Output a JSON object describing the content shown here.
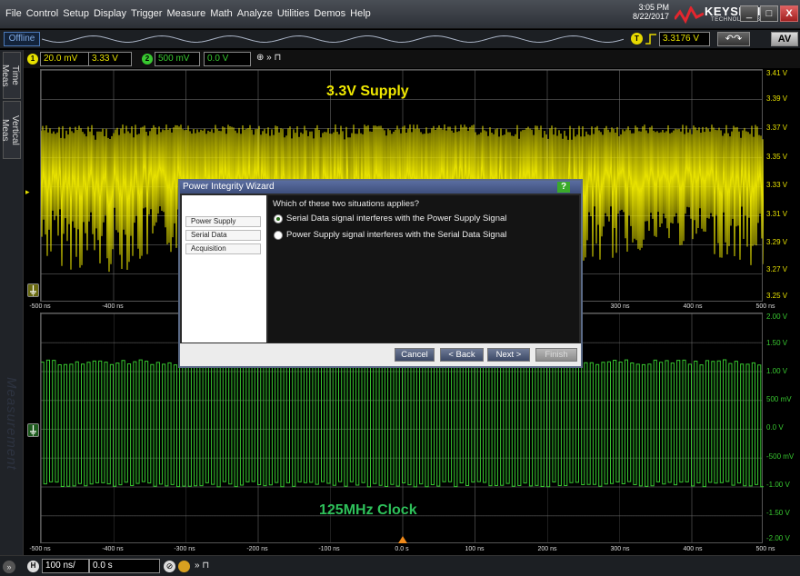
{
  "menu": [
    "File",
    "Control",
    "Setup",
    "Display",
    "Trigger",
    "Measure",
    "Math",
    "Analyze",
    "Utilities",
    "Demos",
    "Help"
  ],
  "clock": {
    "time": "3:05 PM",
    "date": "8/22/2017"
  },
  "brand": {
    "name": "KEYSIGHT",
    "sub": "TECHNOLOGIES"
  },
  "window_buttons": {
    "minimize": "_",
    "maximize": "□",
    "close": "X"
  },
  "status": {
    "offline": "Offline",
    "trigger_badge": "T",
    "trigger_level": "3.3176 V",
    "undo_label": "↶↷",
    "autoscale_label": "AV"
  },
  "channels": [
    {
      "badge": "1",
      "scale": "20.0 mV",
      "offset": "3.33 V",
      "color": "#e6e000"
    },
    {
      "badge": "2",
      "scale": "500 mV",
      "offset": "0.0 V",
      "color": "#38c830"
    }
  ],
  "chan_controls": "⊕ » ⊓",
  "sidetabs": [
    "Time Meas",
    "Vertical Meas"
  ],
  "side_watermark": "Measurement",
  "top_panel": {
    "title": "3.3V Supply",
    "title_color": "#f0e800",
    "wave_color": "#e6e000",
    "y_labels": [
      "3.41 V",
      "3.39 V",
      "3.37 V",
      "3.35 V",
      "3.33 V",
      "3.31 V",
      "3.29 V",
      "3.27 V",
      "3.25 V"
    ],
    "x_labels": [
      "-500 ns",
      "-400 ns",
      "300 ns",
      "400 ns",
      "500 ns"
    ]
  },
  "bottom_panel": {
    "title": "125MHz Clock",
    "title_color": "#2ec05a",
    "wave_color": "#38c830",
    "y_labels": [
      "2.00 V",
      "1.50 V",
      "1.00 V",
      "500 mV",
      "0.0 V",
      "-500 mV",
      "-1.00 V",
      "-1.50 V",
      "-2.00 V"
    ],
    "x_labels": [
      "-500 ns",
      "-400 ns",
      "-300 ns",
      "-200 ns",
      "-100 ns",
      "0.0 s",
      "100 ns",
      "200 ns",
      "300 ns",
      "400 ns",
      "500 ns"
    ]
  },
  "timebase": {
    "badge": "H",
    "scale": "100 ns/",
    "position": "0.0 s",
    "controls": "» ⊓"
  },
  "dialog": {
    "title": "Power Integrity Wizard",
    "help": "?",
    "nav": [
      "Power Supply",
      "Serial Data",
      "Acquisition"
    ],
    "question": "Which of these two situations applies?",
    "options": [
      {
        "label": "Serial Data signal interferes with the Power Supply Signal",
        "selected": true
      },
      {
        "label": "Power Supply signal interferes with the Serial Data Signal",
        "selected": false
      }
    ],
    "buttons": {
      "cancel": "Cancel",
      "back": "< Back",
      "next": "Next >",
      "finish": "Finish"
    }
  }
}
